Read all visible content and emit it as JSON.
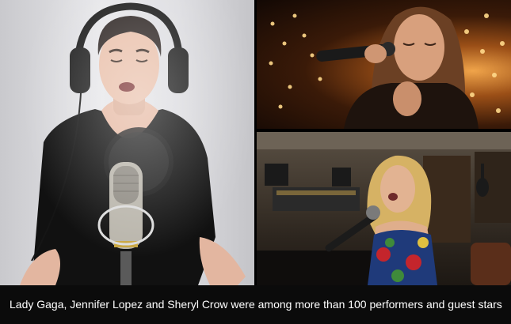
{
  "caption": {
    "text": "Lady Gaga, Jennifer Lopez and Sheryl Crow were among more than 100 performers and guest stars"
  },
  "colors": {
    "caption_bar": "#0b0b0b",
    "caption_text": "#ffffff",
    "studio_wall": "#e1e1e4",
    "concert_glow": "#f0a44a",
    "piano_room": "#3a3128"
  },
  "panels": [
    {
      "id": "studio-singer",
      "description_icon": "headphones-icon"
    },
    {
      "id": "concert-singer",
      "description_icon": "handheld-microphone-icon"
    },
    {
      "id": "piano-singer",
      "description_icon": "piano-icon"
    }
  ]
}
